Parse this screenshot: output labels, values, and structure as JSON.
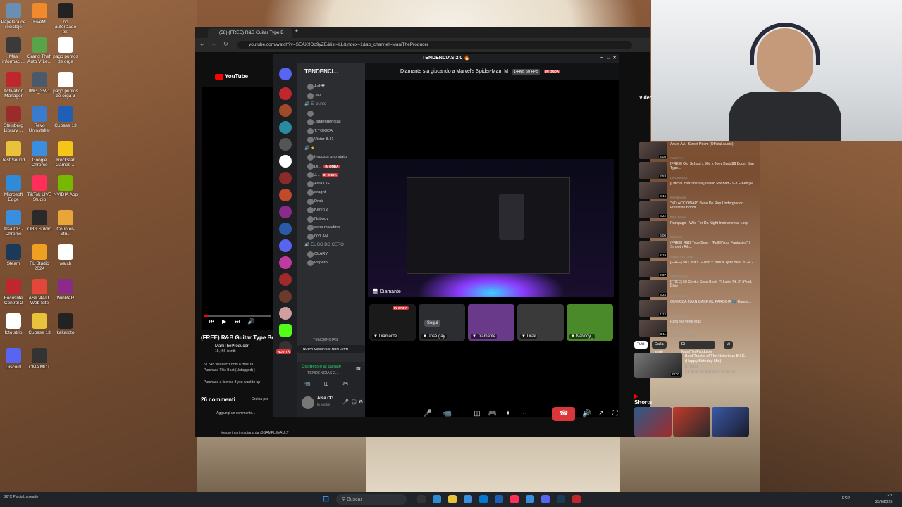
{
  "desktop": {
    "icons": [
      {
        "label": "Papelera de reciclaje",
        "color": "#6a8fb5"
      },
      {
        "label": "FiveM",
        "color": "#f08a2c"
      },
      {
        "label": "no autorizado pkt",
        "color": "#222222"
      },
      {
        "label": "Mas informaci...",
        "color": "#3a3a3a"
      },
      {
        "label": "Grand Theft Auto V Le...",
        "color": "#5aa34a"
      },
      {
        "label": "pago puntos de orga",
        "color": "#ffffff"
      },
      {
        "label": "Activation Manager",
        "color": "#c0262d"
      },
      {
        "label": "IMG_3591",
        "color": "#4a5a6a"
      },
      {
        "label": "pago puntos de orga 3",
        "color": "#ffffff"
      },
      {
        "label": "Steinberg Library ...",
        "color": "#9a2b2b"
      },
      {
        "label": "Revo Uninstaller",
        "color": "#3c7acb"
      },
      {
        "label": "Cubase 13",
        "color": "#1f5fb5"
      },
      {
        "label": "Test Sound",
        "color": "#e8c23a"
      },
      {
        "label": "Google Chrome",
        "color": "#3a8ee0"
      },
      {
        "label": "Rockstar Games ...",
        "color": "#f5c518"
      },
      {
        "label": "Microsoft Edge",
        "color": "#2e8bd8"
      },
      {
        "label": "TikTok LIVE Studio",
        "color": "#ff2f5a"
      },
      {
        "label": "NVIDIA App",
        "color": "#76b900"
      },
      {
        "label": "Alsa CG - Chrome",
        "color": "#3a8ee0"
      },
      {
        "label": "OBS Studio",
        "color": "#2a2a2a"
      },
      {
        "label": "Counter-Stri...",
        "color": "#e8a63a"
      },
      {
        "label": "Steam",
        "color": "#1b3a5a"
      },
      {
        "label": "FL Studio 2024",
        "color": "#f0a020"
      },
      {
        "label": "watch",
        "color": "#ffffff"
      },
      {
        "label": "Focusrite Control 2",
        "color": "#c0262d"
      },
      {
        "label": "ASIO4ALL Web Site",
        "color": "#e2473a"
      },
      {
        "label": "WinRAR",
        "color": "#8a2b8a"
      },
      {
        "label": "foto strip",
        "color": "#ffffff"
      },
      {
        "label": "Cubase 13",
        "color": "#e8c23a"
      },
      {
        "label": "kakaroto",
        "color": "#222222"
      },
      {
        "label": "Discord",
        "color": "#5865f2"
      },
      {
        "label": "CMA MDT",
        "color": "#333333"
      }
    ]
  },
  "browser": {
    "tab_title": "(58) (FREE) R&B Guitar Type B",
    "url": "youtube.com/watch?v=SEAX9Do9yZE&list=LL&index=1&ab_channel=ManiTheProducer",
    "youtube": {
      "logo": "YouTube",
      "video_title": "(FREE) R&B Guitar Type Beat",
      "channel": "ManiTheProducer",
      "subscribers": "15,466 iscritti",
      "stats": "51.545 visualizzazioni 8 mesi fa",
      "desc1": "Purchase This Beat (Untagged) |",
      "desc2": "Purchase a license if you want to up",
      "comments_count": "26 commenti",
      "sort": "Ordina per",
      "add_comment": "Aggiungi un commento...",
      "pinned_note": "Messo in primo piano da @SAMPLEVAULT",
      "side_header": "Video",
      "related": [
        {
          "title": "Anuel AA - Street Poem (Official Audio)",
          "channel": "Anuel AA",
          "duration": "4:08"
        },
        {
          "title": "[FREE] Old School x 90s x Joey Bada$$ Boom Bap Type...",
          "channel": "LeRueMusic",
          "duration": "2:53"
        },
        {
          "title": "[Official Instrumental] Isaiah Rashad - 9-3 Freestyle",
          "channel": "Kishamusic",
          "duration": "3:46"
        },
        {
          "title": "\"NO ACCIONAR\" Base De Rap Underground Freestyle Boom...",
          "channel": "RPK Beats",
          "duration": "3:22"
        },
        {
          "title": "Rampage - Wild For Da Night Instrumental Loop",
          "channel": "Batloosh",
          "duration": "6:00"
        },
        {
          "title": "(FREE) R&B Type Beat - \"Fulfill Your Fantasies\" | Smooth R&...",
          "channel": "Ready For Love",
          "duration": "4:19"
        },
        {
          "title": "[FREE] 50 Cent x G-Unit x 2000s Type Beat 2024 -...",
          "channel": "reBeatSpace",
          "duration": "2:37"
        },
        {
          "title": "[FREE] 50 Cent x Sosa Beat - \"Hustle Pt. 2\" (Prod. Elvis...",
          "channel": "ElvisProduct",
          "duration": "3:24"
        },
        {
          "title": "QUERIDA JUAN GABRIEL PARODIA 🌚 Rumor...",
          "channel": "No Name TV",
          "duration": "1:12"
        },
        {
          "title": "Para No Verte Más",
          "channel": "La Mosca (Oficial)",
          "duration": "3:11"
        }
      ],
      "chips": [
        "Tutti",
        "Dalla serie",
        "Di ManiTheProducer",
        "Vi"
      ],
      "featured": {
        "title": "Best Tracks of The Notorious B.I.G. (Happy Birthday Mix)",
        "channel": "DJ Rizzo",
        "meta": "8,9 Mln di visualizzazioni • 5 anni fa",
        "duration": "28:03"
      },
      "shorts_label": "Shorts"
    }
  },
  "discord": {
    "window_title": "TENDENCIAS 2.0 🔥",
    "server_name": "TENDENCI...",
    "stream_header": "Diamante sta giocando a Marvel's Spider-Man: M",
    "quality": "1440p 60 FPS",
    "live_label": "IN ONDA",
    "rows": [
      {
        "kind": "user",
        "text": "Ash❤"
      },
      {
        "kind": "user",
        "text": "Javi"
      },
      {
        "kind": "cat",
        "text": "El punto"
      },
      {
        "kind": "user",
        "text": " "
      },
      {
        "kind": "user",
        "text": ".gg/tendencias"
      },
      {
        "kind": "user",
        "text": "T.TOXICA"
      },
      {
        "kind": "user",
        "text": "Victor 8.41"
      },
      {
        "kind": "chan",
        "text": " "
      },
      {
        "kind": "user",
        "text": "Imposta uno stato"
      },
      {
        "kind": "live",
        "text": "Di..."
      },
      {
        "kind": "live",
        "text": "J..."
      },
      {
        "kind": "user",
        "text": "Alsa CG"
      },
      {
        "kind": "user",
        "text": "draght"
      },
      {
        "kind": "user",
        "text": "Drak"
      },
      {
        "kind": "user",
        "text": "Kerlin Z"
      },
      {
        "kind": "user",
        "text": "Nabody_"
      },
      {
        "kind": "user",
        "text": "sexo matutino"
      },
      {
        "kind": "user",
        "text": "DYLAN"
      },
      {
        "kind": "cat",
        "text": "EL BO BO CERO"
      },
      {
        "kind": "user",
        "text": "CLARY"
      },
      {
        "kind": "user",
        "text": "Papero"
      }
    ],
    "tendencias_tag": "TENDENCIAS",
    "new_messages": "NUOVI MESSAGGI NON LETTI",
    "new_badge": "NOVITÀ",
    "voice_connected": "Connesso al canale",
    "voice_channel": "TENDENCIAS 2...",
    "user_name": "Alsa CG",
    "user_status": "In vocale",
    "stream_owner": "Diamante",
    "tiles": [
      {
        "name": "Diamante",
        "live": "IN ONDA",
        "bg": "#1a1a1a"
      },
      {
        "name": "José gay",
        "button": "Segui",
        "bg": "#2b2d31"
      },
      {
        "name": "Diamante",
        "bg": "#6a3a8a"
      },
      {
        "name": "Drak",
        "bg": "#3a3a3a"
      },
      {
        "name": "Nabody_",
        "bg": "#4a8a2a"
      }
    ]
  },
  "taskbar": {
    "search_placeholder": "Buscar",
    "weather": "26°C Parcial. soleado",
    "lang": "ESP",
    "time": "12:17",
    "date": "23/6/2025"
  }
}
